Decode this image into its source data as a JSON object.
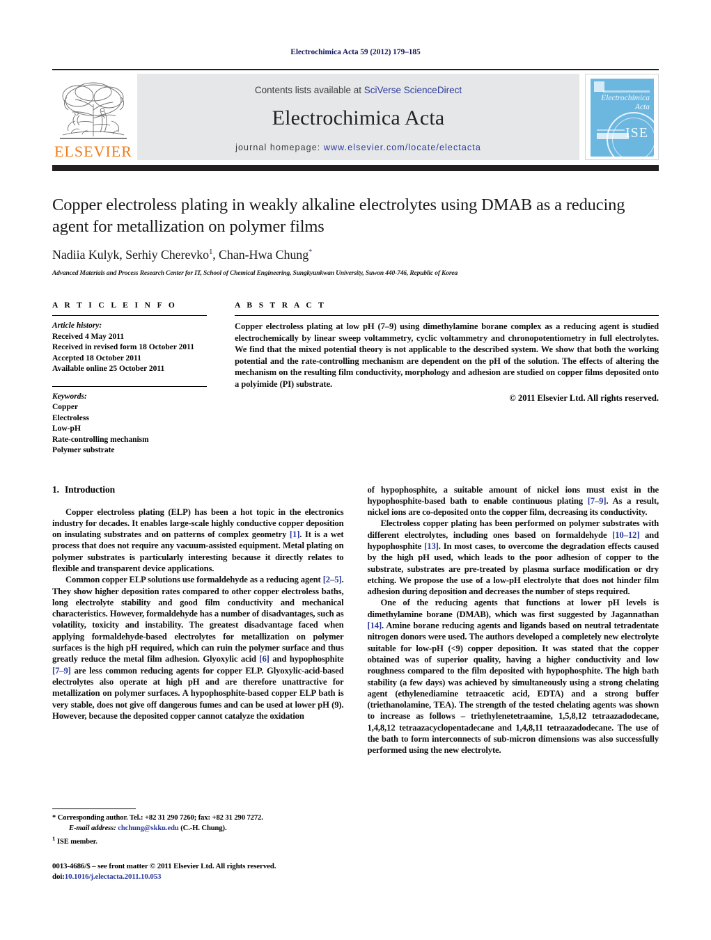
{
  "running_head": "Electrochimica Acta 59 (2012) 179–185",
  "masthead": {
    "publisher_name": "ELSEVIER",
    "contents_prefix": "Contents lists available at ",
    "sciencedirect_link": "SciVerse ScienceDirect",
    "journal_title": "Electrochimica Acta",
    "homepage_prefix": "journal homepage: ",
    "homepage_url": "www.elsevier.com/locate/electacta",
    "cover": {
      "title_line1": "Electrochimica",
      "title_line2": "Acta",
      "society_mark": "ISE",
      "cover_color": "#6cb7e0"
    }
  },
  "article": {
    "title": "Copper electroless plating in weakly alkaline electrolytes using DMAB as a reducing agent for metallization on polymer films",
    "authors_part1": "Nadiia Kulyk, Serhiy Cherevko",
    "author_sup1": "1",
    "authors_part2": ", Chan-Hwa Chung",
    "author_star": "*",
    "affiliation": "Advanced Materials and Process Research Center for IT, School of Chemical Engineering, Sungkyunkwan University, Suwon 440-746, Republic of Korea"
  },
  "article_info": {
    "label": "A R T I C L E    I N F O",
    "history_heading": "Article history:",
    "history": [
      "Received 4 May 2011",
      "Received in revised form 18 October 2011",
      "Accepted 18 October 2011",
      "Available online 25 October 2011"
    ],
    "keywords_heading": "Keywords:",
    "keywords": [
      "Copper",
      "Electroless",
      "Low-pH",
      "Rate-controlling mechanism",
      "Polymer substrate"
    ]
  },
  "abstract": {
    "label": "A B S T R A C T",
    "text": "Copper electroless plating at low pH (7–9) using dimethylamine borane complex as a reducing agent is studied electrochemically by linear sweep voltammetry, cyclic voltammetry and chronopotentiometry in full electrolytes. We find that the mixed potential theory is not applicable to the described system. We show that both the working potential and the rate-controlling mechanism are dependent on the pH of the solution. The effects of altering the mechanism on the resulting film conductivity, morphology and adhesion are studied on copper films deposited onto a polyimide (PI) substrate.",
    "copyright": "© 2011 Elsevier Ltd. All rights reserved."
  },
  "introduction": {
    "heading_number": "1.",
    "heading_text": "Introduction",
    "left_paragraphs": [
      {
        "segments": [
          {
            "t": "Copper electroless plating (ELP) has been a hot topic in the electronics industry for decades. It enables large-scale highly conductive copper deposition on insulating substrates and on patterns of complex geometry "
          },
          {
            "t": "[1]",
            "ref": true
          },
          {
            "t": ". It is a wet process that does not require any vacuum-assisted equipment. Metal plating on polymer substrates is particularly interesting because it directly relates to flexible and transparent device applications."
          }
        ]
      },
      {
        "segments": [
          {
            "t": "Common copper ELP solutions use formaldehyde as a reducing agent "
          },
          {
            "t": "[2–5]",
            "ref": true
          },
          {
            "t": ". They show higher deposition rates compared to other copper electroless baths, long electrolyte stability and good film conductivity and mechanical characteristics. However, formaldehyde has a number of disadvantages, such as volatility, toxicity and instability. The greatest disadvantage faced when applying formaldehyde-based electrolytes for metallization on polymer surfaces is the high pH required, which can ruin the polymer surface and thus greatly reduce the metal film adhesion. Glyoxylic acid "
          },
          {
            "t": "[6]",
            "ref": true
          },
          {
            "t": " and hypophosphite "
          },
          {
            "t": "[7–9]",
            "ref": true
          },
          {
            "t": " are less common reducing agents for copper ELP. Glyoxylic-acid-based electrolytes also operate at high pH and are therefore unattractive for metallization on polymer surfaces. A hypophosphite-based copper ELP bath is very stable, does not give off dangerous fumes and can be used at lower pH (9). However, because the deposited copper cannot catalyze the oxidation"
          }
        ]
      }
    ],
    "right_paragraphs": [
      {
        "noindent": true,
        "segments": [
          {
            "t": "of hypophosphite, a suitable amount of nickel ions must exist in the hypophosphite-based bath to enable continuous plating "
          },
          {
            "t": "[7–9]",
            "ref": true
          },
          {
            "t": ". As a result, nickel ions are co-deposited onto the copper film, decreasing its conductivity."
          }
        ]
      },
      {
        "segments": [
          {
            "t": "Electroless copper plating has been performed on polymer substrates with different electrolytes, including ones based on formaldehyde "
          },
          {
            "t": "[10–12]",
            "ref": true
          },
          {
            "t": " and hypophosphite "
          },
          {
            "t": "[13]",
            "ref": true
          },
          {
            "t": ". In most cases, to overcome the degradation effects caused by the high pH used, which leads to the poor adhesion of copper to the substrate, substrates are pre-treated by plasma surface modification or dry etching. We propose the use of a low-pH electrolyte that does not hinder film adhesion during deposition and decreases the number of steps required."
          }
        ]
      },
      {
        "segments": [
          {
            "t": "One of the reducing agents that functions at lower pH levels is dimethylamine borane (DMAB), which was first suggested by Jagannathan "
          },
          {
            "t": "[14]",
            "ref": true
          },
          {
            "t": ". Amine borane reducing agents and ligands based on neutral tetradentate nitrogen donors were used. The authors developed a completely new electrolyte suitable for low-pH (<9) copper deposition. It was stated that the copper obtained was of superior quality, having a higher conductivity and low roughness compared to the film deposited with hypophosphite. The high bath stability (a few days) was achieved by simultaneously using a strong chelating agent (ethylenediamine tetraacetic acid, EDTA) and a strong buffer (triethanolamine, TEA). The strength of the tested chelating agents was shown to increase as follows – triethylenetetraamine, 1,5,8,12 tetraazadodecane, 1,4,8,12 tetraazacyclopentadecane and 1,4,8,11 tetraazadodecane. The use of the bath to form interconnects of sub-micron dimensions was also successfully performed using the new electrolyte."
          }
        ]
      }
    ]
  },
  "footnotes": {
    "corresponding": "* Corresponding author. Tel.: +82 31 290 7260; fax: +82 31 290 7272.",
    "email_label": "E-mail address:",
    "email": "chchung@skku.edu",
    "email_suffix": " (C.-H. Chung).",
    "ise_mark": "1",
    "ise_text": "ISE member."
  },
  "imprint": {
    "line1": "0013-4686/$ – see front matter © 2011 Elsevier Ltd. All rights reserved.",
    "doi_prefix": "doi:",
    "doi": "10.1016/j.electacta.2011.10.053"
  }
}
